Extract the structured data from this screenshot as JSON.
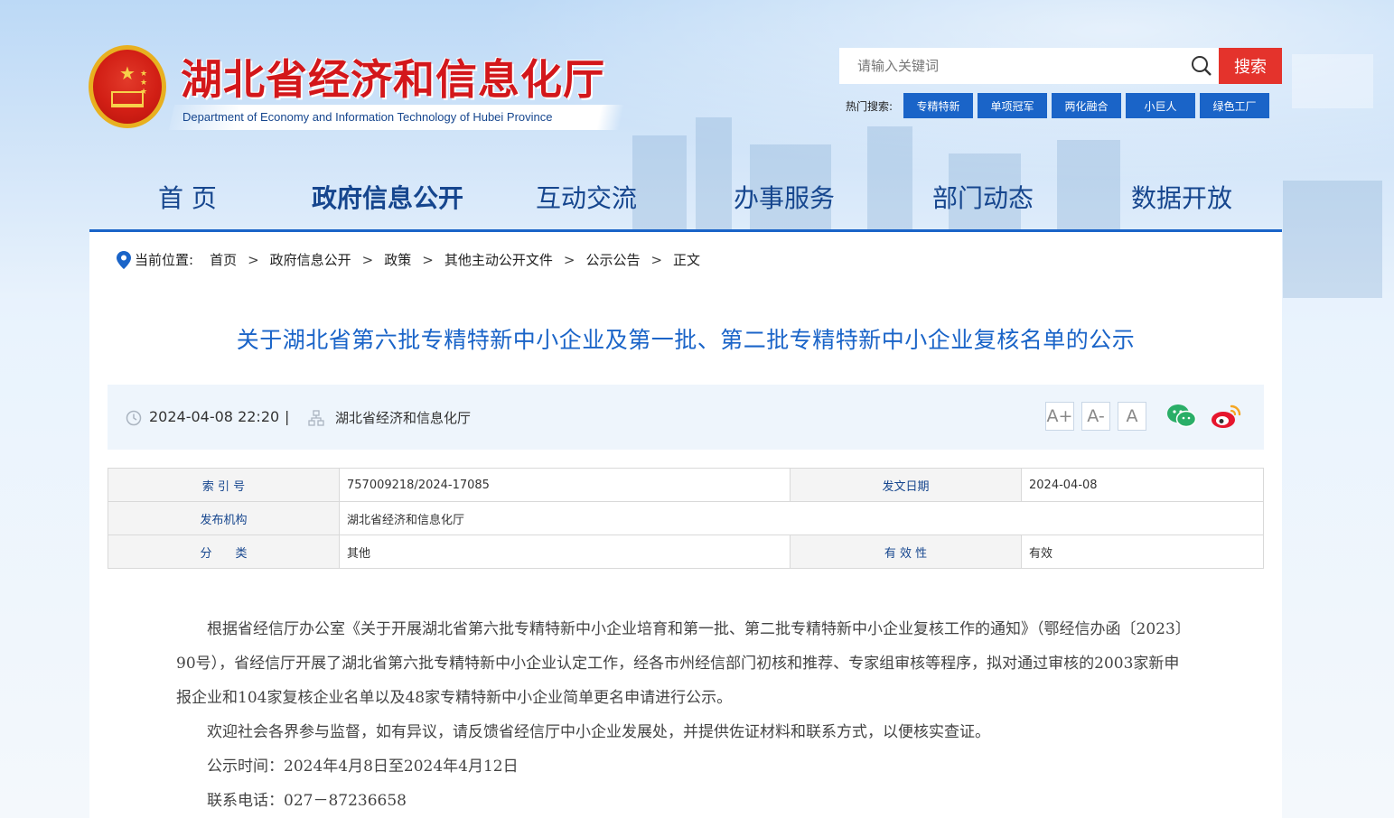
{
  "header": {
    "site_title": "湖北省经济和信息化厅",
    "site_subtitle": "Department of Economy and Information Technology of Hubei Province",
    "search_placeholder": "请输入关键词",
    "search_button": "搜索",
    "hot_label": "热门搜索:",
    "hot_tags": [
      "专精特新",
      "单项冠军",
      "两化融合",
      "小巨人",
      "绿色工厂"
    ]
  },
  "nav": {
    "items": [
      "首 页",
      "政府信息公开",
      "互动交流",
      "办事服务",
      "部门动态",
      "数据开放"
    ],
    "active": "政府信息公开"
  },
  "breadcrumb": {
    "label": "当前位置:",
    "items": [
      "首页",
      "政府信息公开",
      "政策",
      "其他主动公开文件",
      "公示公告",
      "正文"
    ],
    "separator": ">"
  },
  "article": {
    "title": "关于湖北省第六批专精特新中小企业及第一批、第二批专精特新中小企业复核名单的公示",
    "datetime": "2024-04-08 22:20",
    "divider": "|",
    "source": "湖北省经济和信息化厅",
    "font_buttons": [
      "A+",
      "A-",
      "A"
    ]
  },
  "info_table": {
    "index_label": "索 引 号",
    "index_value": "757009218/2024-17085",
    "date_label": "发文日期",
    "date_value": "2024-04-08",
    "org_label": "发布机构",
    "org_value": "湖北省经济和信息化厅",
    "category_label": "分　　类",
    "category_value": "其他",
    "validity_label": "有 效 性",
    "validity_value": "有效"
  },
  "body": {
    "p1": "根据省经信厅办公室《关于开展湖北省第六批专精特新中小企业培育和第一批、第二批专精特新中小企业复核工作的通知》（鄂经信办函〔2023〕90号），省经信厅开展了湖北省第六批专精特新中小企业认定工作，经各市州经信部门初核和推荐、专家组审核等程序，拟对通过审核的2003家新申报企业和104家复核企业名单以及48家专精特新中小企业简单更名申请进行公示。",
    "p2": "欢迎社会各界参与监督，如有异议，请反馈省经信厅中小企业发展处，并提供佐证材料和联系方式，以便核实查证。",
    "p3": "公示时间：2024年4月8日至2024年4月12日",
    "p4": "联系电话：027－87236658"
  },
  "colors": {
    "brand_red": "#d3171b",
    "brand_blue": "#1a64c8",
    "search_red": "#e4332c"
  },
  "icons": {
    "search": "search-icon",
    "location": "location-pin-icon",
    "clock": "clock-icon",
    "org": "organization-icon",
    "wechat": "wechat-icon",
    "weibo": "weibo-icon"
  }
}
